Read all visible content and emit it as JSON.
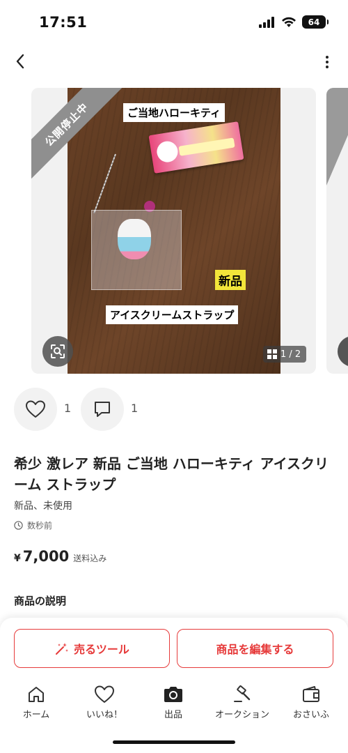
{
  "status_bar": {
    "time": "17:51",
    "battery": "64"
  },
  "nav": {
    "back_icon": "chevron-left-icon",
    "more_icon": "vertical-dots-icon"
  },
  "gallery": {
    "banner": "公開停止中",
    "caption_title": "ご当地ハローキティ",
    "caption_new": "新品",
    "caption_bottom": "アイスクリームストラップ",
    "page_indicator": "1 / 2",
    "zoom_icon": "image-search-icon"
  },
  "reactions": {
    "like_count": "1",
    "comment_count": "1"
  },
  "item": {
    "title": "希少 激レア 新品 ご当地 ハローキティ アイスクリーム ストラップ",
    "condition": "新品、未使用",
    "posted": "数秒前",
    "price_symbol": "¥",
    "price": "7,000",
    "price_note": "送料込み",
    "description_heading": "商品の説明"
  },
  "actions": {
    "sell_tool": "売るツール",
    "edit_item": "商品を編集する"
  },
  "tab_bar": {
    "tabs": [
      {
        "label": "ホーム",
        "icon": "home-icon"
      },
      {
        "label": "いいね！",
        "icon": "heart-icon"
      },
      {
        "label": "出品",
        "icon": "camera-icon"
      },
      {
        "label": "オークション",
        "icon": "gavel-icon"
      },
      {
        "label": "おさいふ",
        "icon": "wallet-icon"
      }
    ]
  },
  "colors": {
    "accent": "#e63a3a",
    "banner_gray": "#8f8f8f",
    "caption_highlight": "#f2e53a"
  }
}
